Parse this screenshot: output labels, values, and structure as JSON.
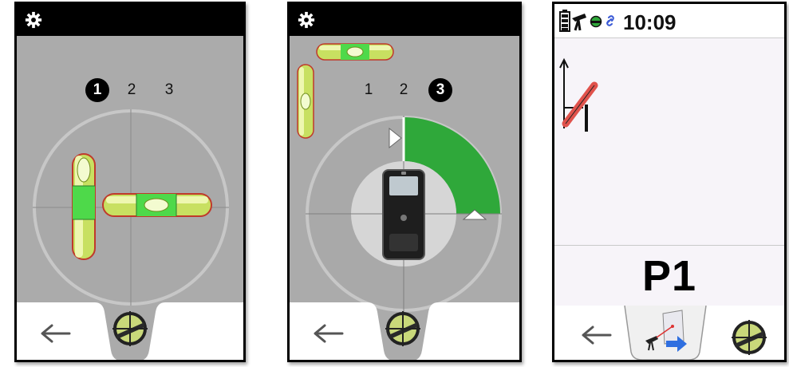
{
  "screens": [
    {
      "steps": [
        "1",
        "2",
        "3"
      ],
      "active_step": 1
    },
    {
      "steps": [
        "1",
        "2",
        "3"
      ],
      "active_step": 3
    },
    {
      "status_time": "10:09",
      "point_label": "P1"
    }
  ],
  "icons": {
    "settings": "gear-icon",
    "back": "arrow-left-icon",
    "level": "level-target-icon",
    "measure": "point-transfer-icon"
  },
  "colors": {
    "bubble_green": "#49d94a",
    "arc_green": "#2fa83a",
    "panel_gray": "#ababab",
    "tilt_red": "#e0524c"
  }
}
